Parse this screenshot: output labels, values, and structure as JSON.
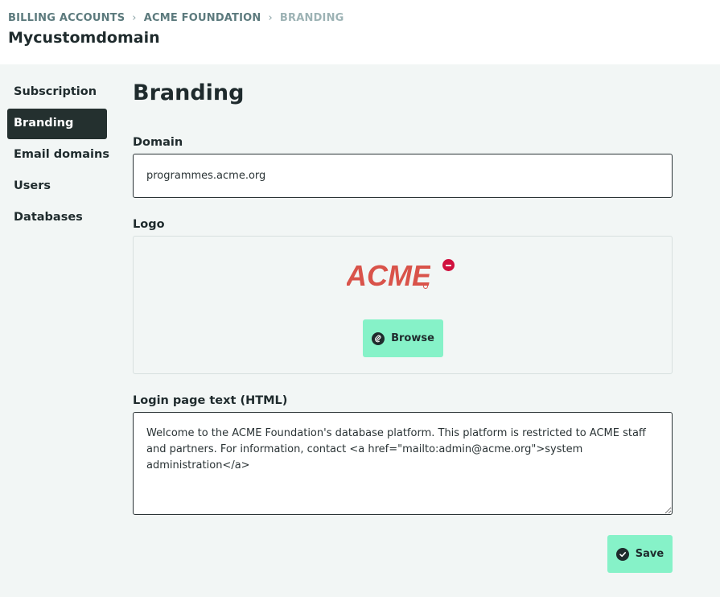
{
  "breadcrumb": {
    "items": [
      "BILLING ACCOUNTS",
      "ACME FOUNDATION"
    ],
    "current": "BRANDING"
  },
  "app": {
    "title": "Mycustomdomain"
  },
  "sidebar": {
    "items": [
      {
        "label": "Subscription",
        "active": false
      },
      {
        "label": "Branding",
        "active": true
      },
      {
        "label": "Email domains",
        "active": false
      },
      {
        "label": "Users",
        "active": false
      },
      {
        "label": "Databases",
        "active": false
      }
    ]
  },
  "main": {
    "heading": "Branding",
    "domain": {
      "label": "Domain",
      "value": "programmes.acme.org"
    },
    "logo": {
      "label": "Logo",
      "image_text": "ACME",
      "remove_icon": "remove-circle-icon",
      "browse_label": "Browse",
      "browse_icon": "paperclip-icon"
    },
    "login_text": {
      "label": "Login page text (HTML)",
      "value": "Welcome to the ACME Foundation's database platform. This platform is restricted to ACME staff and partners. For information, contact <a href=\"mailto:admin@acme.org\">system administration</a>"
    },
    "save": {
      "label": "Save",
      "icon": "check-circle-icon"
    }
  },
  "colors": {
    "accent": "#86f2c8",
    "sidebar_active": "#24302f",
    "danger": "#d0103e",
    "logo_red": "#d9534a",
    "background": "#f2f6f5"
  }
}
